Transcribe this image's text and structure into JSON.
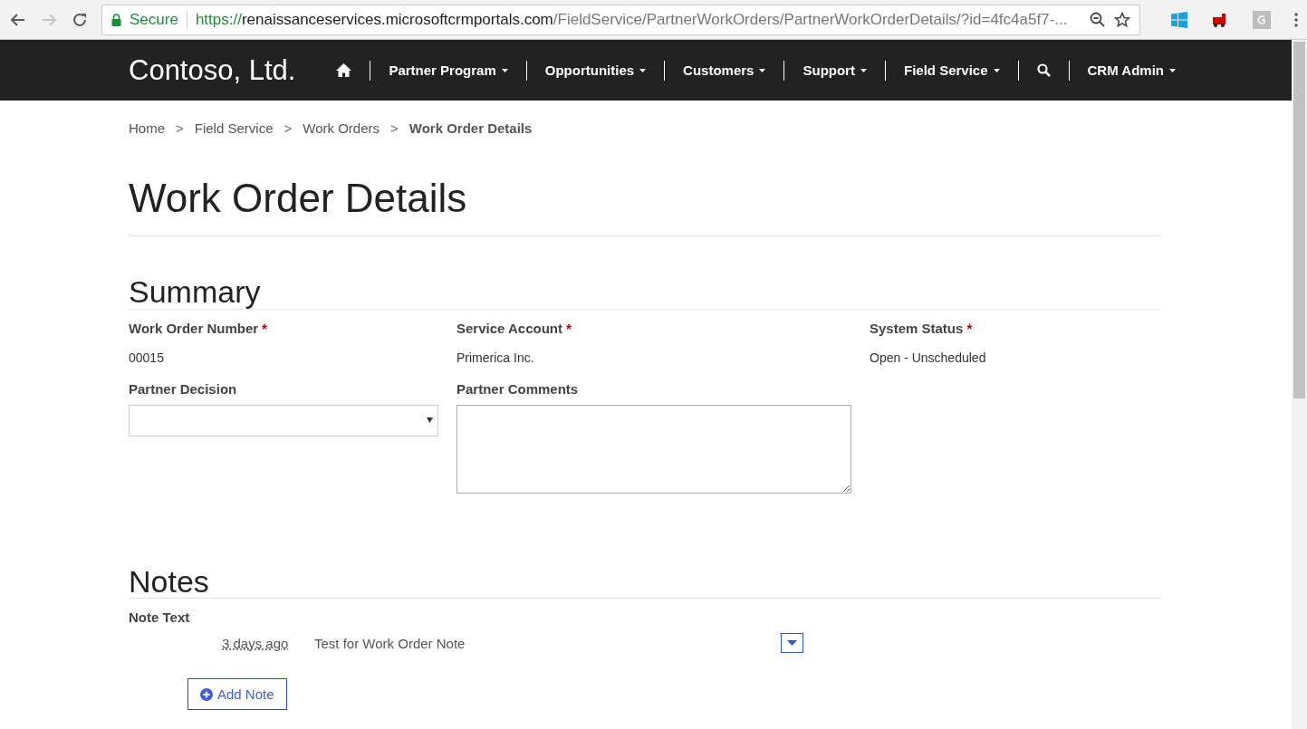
{
  "browser": {
    "secure_label": "Secure",
    "url": {
      "scheme": "https://",
      "host": "renaissanceservices.microsoftcrmportals.com",
      "path": "/FieldService/PartnerWorkOrders/PartnerWorkOrderDetails/?id=4fc4a5f7-..."
    }
  },
  "navbar": {
    "brand": "Contoso, Ltd.",
    "items": [
      {
        "kind": "home"
      },
      {
        "kind": "menu",
        "label": "Partner Program"
      },
      {
        "kind": "menu",
        "label": "Opportunities"
      },
      {
        "kind": "menu",
        "label": "Customers"
      },
      {
        "kind": "menu",
        "label": "Support"
      },
      {
        "kind": "menu",
        "label": "Field Service"
      },
      {
        "kind": "search"
      },
      {
        "kind": "menu",
        "label": "CRM Admin"
      }
    ]
  },
  "breadcrumb": [
    {
      "label": "Home",
      "current": false
    },
    {
      "label": "Field Service",
      "current": false
    },
    {
      "label": "Work Orders",
      "current": false
    },
    {
      "label": "Work Order Details",
      "current": true
    }
  ],
  "breadcrumb_separator": ">",
  "page_title": "Work Order Details",
  "summary": {
    "heading": "Summary",
    "fields": [
      {
        "kind": "text",
        "label": "Work Order Number",
        "marker": "*",
        "value": "00015"
      },
      {
        "kind": "text",
        "label": "Service Account",
        "marker": "*",
        "value": "Primerica Inc."
      },
      {
        "kind": "text",
        "label": "System Status",
        "marker": "*",
        "value": "Open - Unscheduled"
      },
      {
        "kind": "select",
        "label": "Partner Decision"
      },
      {
        "kind": "textarea",
        "label": "Partner Comments"
      }
    ]
  },
  "notes": {
    "heading": "Notes",
    "column_label": "Note Text",
    "items": [
      {
        "time": "3 days ago",
        "text": "Test for Work Order Note"
      }
    ],
    "add_button": "Add Note"
  }
}
